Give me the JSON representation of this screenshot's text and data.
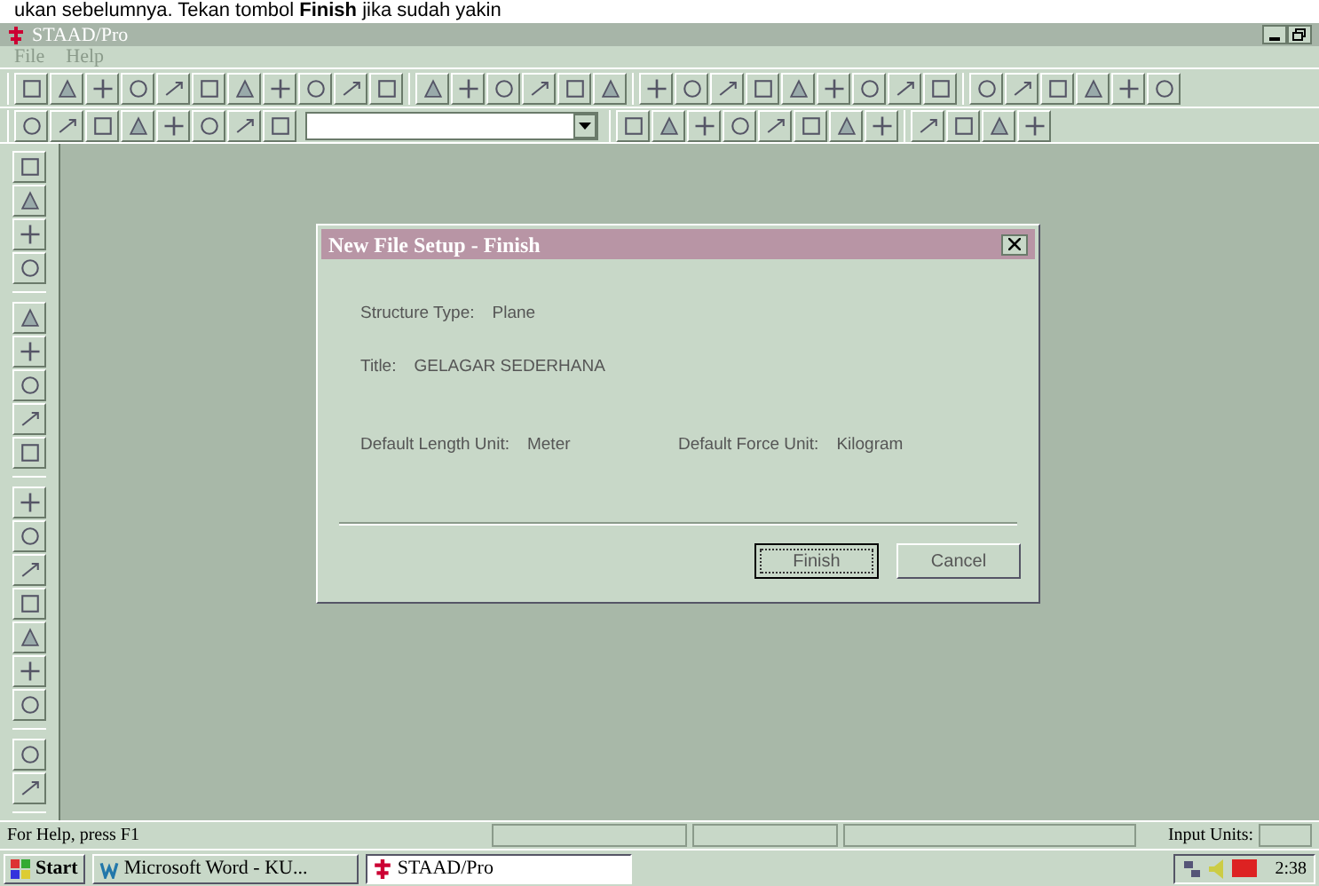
{
  "document_caption": "ukan sebelumnya. Tekan tombol **Finish** jika sudah yakin",
  "window": {
    "title": "STAAD/Pro"
  },
  "menu": [
    {
      "label": "File",
      "disabled": true
    },
    {
      "label": "Help",
      "disabled": true
    }
  ],
  "dialog": {
    "title": "New File Setup - Finish",
    "fields": [
      {
        "label": "Structure Type:",
        "value": "Plane"
      },
      {
        "label": "Title:",
        "value": "GELAGAR SEDERHANA"
      },
      {
        "label": "Default Length Unit:",
        "value": "Meter"
      },
      {
        "label": "Default Force Unit:",
        "value": "Kilogram"
      }
    ],
    "buttons": [
      {
        "label": "Finish",
        "focused": true
      },
      {
        "label": "Cancel",
        "focused": false
      }
    ]
  },
  "status_bar": {
    "help": "For Help, press F1",
    "units_label": "Input Units:"
  },
  "taskbar": {
    "start": "Start",
    "tasks": [
      {
        "label": "Microsoft Word - KU...",
        "selected": false
      },
      {
        "label": "STAAD/Pro",
        "selected": true
      }
    ],
    "time": "2:38"
  }
}
